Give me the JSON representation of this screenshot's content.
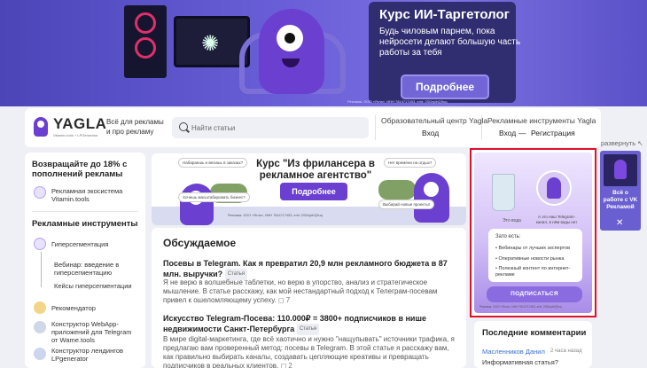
{
  "top_banner": {
    "title": "Курс ИИ-Таргетолог",
    "text": "Будь чиловым парнем, пока нейросети делают большую часть работы за тебя",
    "button": "Подробнее",
    "legal": "Реклама. ООО «Ягла», ИНН 7814717453, erid: 2SDnjdhQ9uq"
  },
  "header": {
    "logo": "YAGLA",
    "logo_sub": "Vitamin.tools + LPGenerator",
    "tagline": "Всё для рекламы и про рекламу",
    "search_placeholder": "Найти статьи",
    "edu_title": "Образовательный центр Yagla",
    "edu_login": "Вход",
    "tools_title": "Рекламные инструменты Yagla",
    "tools_login": "Вход",
    "tools_sep": "—",
    "tools_register": "Регистрация"
  },
  "sidebar": {
    "promo": "Возвращайте до 18% с пополнений рекламы",
    "vitamin": "Рекламная экосистема Vitamin.tools",
    "tools_heading": "Рекламные инструменты",
    "hyperseg": "Гиперсегментация",
    "webinar": "Вебинар: введение в гиперсегментацию",
    "cases": "Кейсы гиперсегментации",
    "recommender": "Рекомендатор",
    "webapp": "Конструктор WebApp-приложений для Telegram от Wame.tools",
    "landing": "Конструктор лендингов LPgenerator"
  },
  "center_banner": {
    "title": "Курс \"Из фрилансера в рекламное агентство\"",
    "button": "Подробнее",
    "legal": "Реклама. ООО «Ягла», ИНН 7814717453, erid: 2SDnjdhQ9uq",
    "bubble1": "Набираешь и весишь в заказах?",
    "bubble2": "Хочешь масштабировать бизнес?",
    "bubble3": "Нет времени на отдых?",
    "bubble4": "Выбирай новые проекты!"
  },
  "discussed": {
    "heading": "Обсуждаемое",
    "posts": [
      {
        "title": "Посевы в Telegram. Как я превратил 20,9 млн рекламного бюджета в 87 млн. выручки?",
        "tag": "Статья",
        "text": "Я не верю в волшебные таблетки, но верю в упорство, анализ и стратегическое мышление. В статье расскажу, как мой нестандартный подход к Телеграм-посевам привел к ошеломляющему успеху.",
        "comments": "7"
      },
      {
        "title": "Искусство Telegram-Посева: 110.000₽ = 3800+ подписчиков в нише недвижимости Санкт-Петербурга",
        "tag": "Статья",
        "text": "В мире digital-маркетинга, где всё хаотично и нужно \"нащупывать\" источники трафика, я предлагаю вам проверенный метод: посевы в Telegram. В этой статье я расскажу вам, как правильно выбирать каналы, создавать цепляющие креативы и превращать подписчиков в реальных клиентов.",
        "comments": "2"
      }
    ]
  },
  "right_ad": {
    "water_label": "Это вода",
    "tg_label": "А это наш Telegram-канал, в нём воды нет",
    "card_heading": "Зато есть:",
    "items": [
      "• Вебинары от лучших экспертов",
      "• Оперативные новости рынка",
      "• Полезный контент по интернет-рекламе"
    ],
    "button": "ПОДПИСАТЬСЯ",
    "legal": "Реклама. ООО «Ягла», ИНН 7814717453, erid: 2SDnjdhQ9uq"
  },
  "expand": "развернуть ↖",
  "vk_card": {
    "text": "Всё о работе с VK Рекламой",
    "close": "✕"
  },
  "recent_comments": {
    "heading": "Последние комментарии",
    "author": "Масленников Данил",
    "time": "2 часа назад",
    "text": "Информативная статья?"
  },
  "colors": {
    "accent": "#6b3fd0",
    "highlight_border": "#e0102a",
    "page_bg": "#eef0f5",
    "link": "#3a6fd8"
  }
}
